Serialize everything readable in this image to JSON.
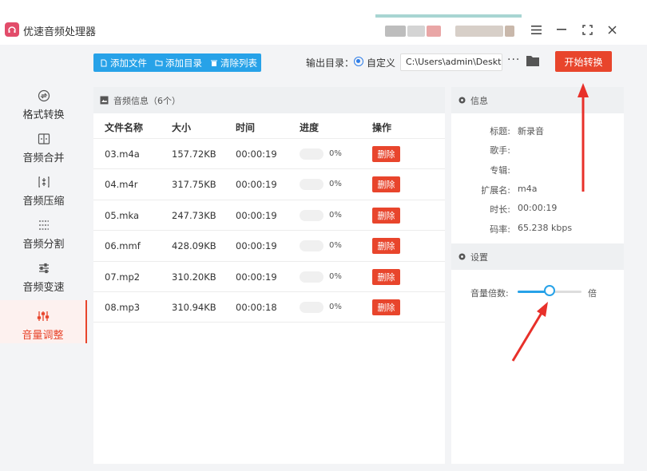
{
  "app": {
    "title": "优速音频处理器",
    "colors": {
      "accent": "#e8452c",
      "primary": "#27a2e8"
    }
  },
  "window_controls": [
    {
      "name": "menu-icon",
      "glyph": "≡"
    },
    {
      "name": "minimize-icon",
      "glyph": "—"
    },
    {
      "name": "maximize-icon",
      "glyph": "⛶"
    },
    {
      "name": "close-icon",
      "glyph": "✕"
    }
  ],
  "sidebar": {
    "items": [
      {
        "label": "格式转换",
        "icon": "format-convert-icon",
        "active": false
      },
      {
        "label": "音频合并",
        "icon": "audio-merge-icon",
        "active": false
      },
      {
        "label": "音频压缩",
        "icon": "audio-compress-icon",
        "active": false
      },
      {
        "label": "音频分割",
        "icon": "audio-split-icon",
        "active": false
      },
      {
        "label": "音频变速",
        "icon": "audio-speed-icon",
        "active": false
      },
      {
        "label": "音量调整",
        "icon": "volume-adjust-icon",
        "active": true
      }
    ]
  },
  "toolbar": {
    "add_file": "添加文件",
    "add_folder": "添加目录",
    "clear_list": "清除列表",
    "output_label": "输出目录：",
    "custom_label": "自定义",
    "output_path": "C:\\Users\\admin\\Deskto",
    "more_label": "···",
    "start_label": "开始转换"
  },
  "file_panel": {
    "title": "音频信息（6个）",
    "columns": [
      "文件名称",
      "大小",
      "时间",
      "进度",
      "操作"
    ],
    "rows": [
      {
        "name": "03.m4a",
        "size": "157.72KB",
        "time": "00:00:19",
        "progress": "0%",
        "progress_value": 0,
        "action": "删除"
      },
      {
        "name": "04.m4r",
        "size": "317.75KB",
        "time": "00:00:19",
        "progress": "0%",
        "progress_value": 0,
        "action": "删除"
      },
      {
        "name": "05.mka",
        "size": "247.73KB",
        "time": "00:00:19",
        "progress": "0%",
        "progress_value": 0,
        "action": "删除"
      },
      {
        "name": "06.mmf",
        "size": "428.09KB",
        "time": "00:00:19",
        "progress": "0%",
        "progress_value": 0,
        "action": "删除"
      },
      {
        "name": "07.mp2",
        "size": "310.20KB",
        "time": "00:00:19",
        "progress": "0%",
        "progress_value": 0,
        "action": "删除"
      },
      {
        "name": "08.mp3",
        "size": "310.94KB",
        "time": "00:00:18",
        "progress": "0%",
        "progress_value": 0,
        "action": "删除"
      }
    ]
  },
  "info_panel": {
    "title": "信息",
    "fields": [
      {
        "key": "标题:",
        "value": "新录音"
      },
      {
        "key": "歌手:",
        "value": ""
      },
      {
        "key": "专辑:",
        "value": ""
      },
      {
        "key": "扩展名:",
        "value": "m4a"
      },
      {
        "key": "时长:",
        "value": "00:00:19"
      },
      {
        "key": "码率:",
        "value": "65.238 kbps"
      }
    ]
  },
  "settings_panel": {
    "title": "设置",
    "volume_label": "音量倍数:",
    "volume_unit": "倍",
    "volume_fraction": 0.5
  }
}
